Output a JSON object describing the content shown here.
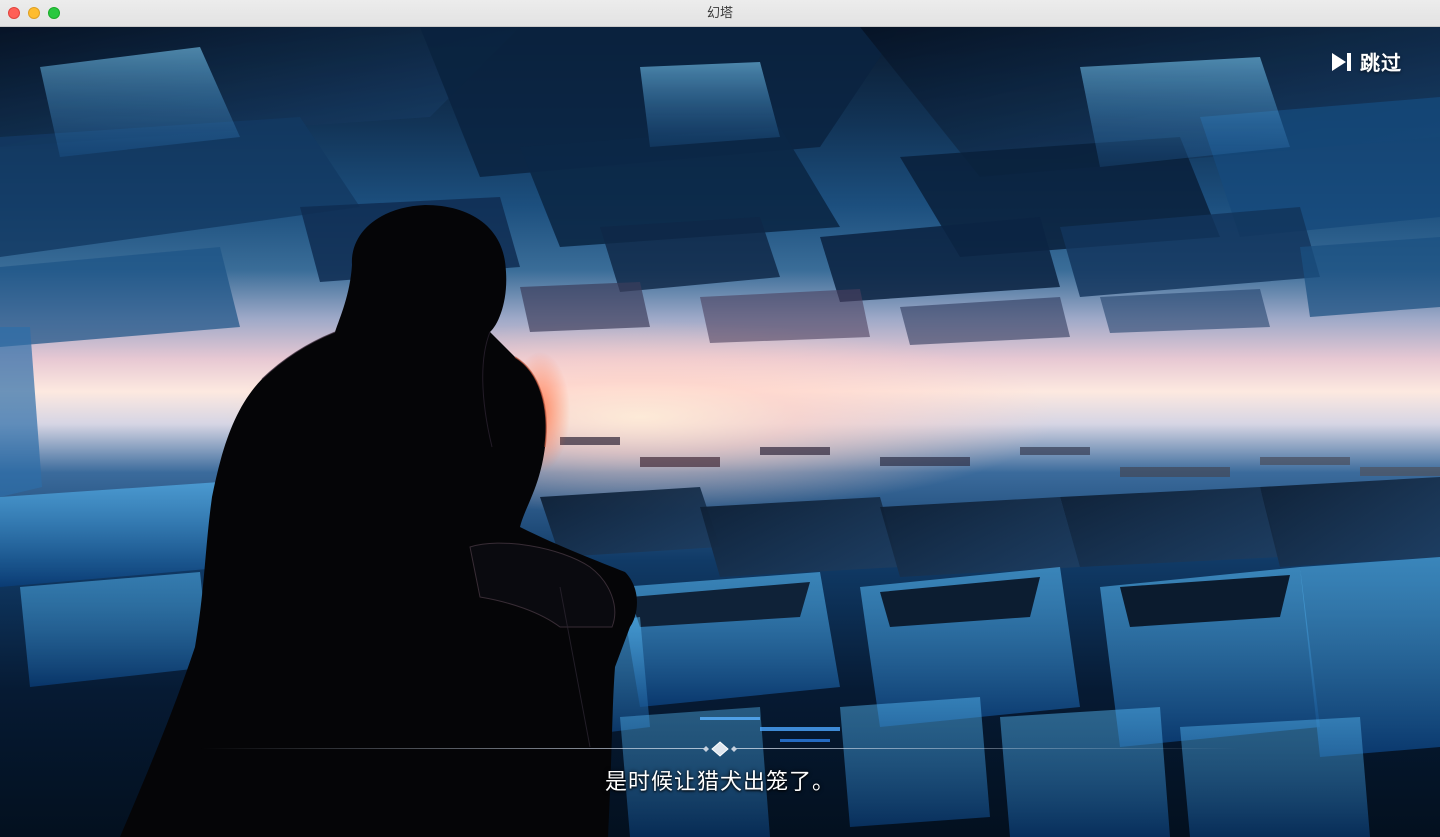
{
  "window": {
    "title": "幻塔"
  },
  "controls": {
    "skip_label": "跳过",
    "skip_icon": "skip-forward-icon"
  },
  "dialogue": {
    "line": "是时候让猎犬出笼了。"
  },
  "colors": {
    "sky_top": "#0a1a2e",
    "horizon_glow": "#fde9e0",
    "cube_blue": "#3fa6e6",
    "silhouette": "#050507",
    "text": "#ffffff"
  }
}
